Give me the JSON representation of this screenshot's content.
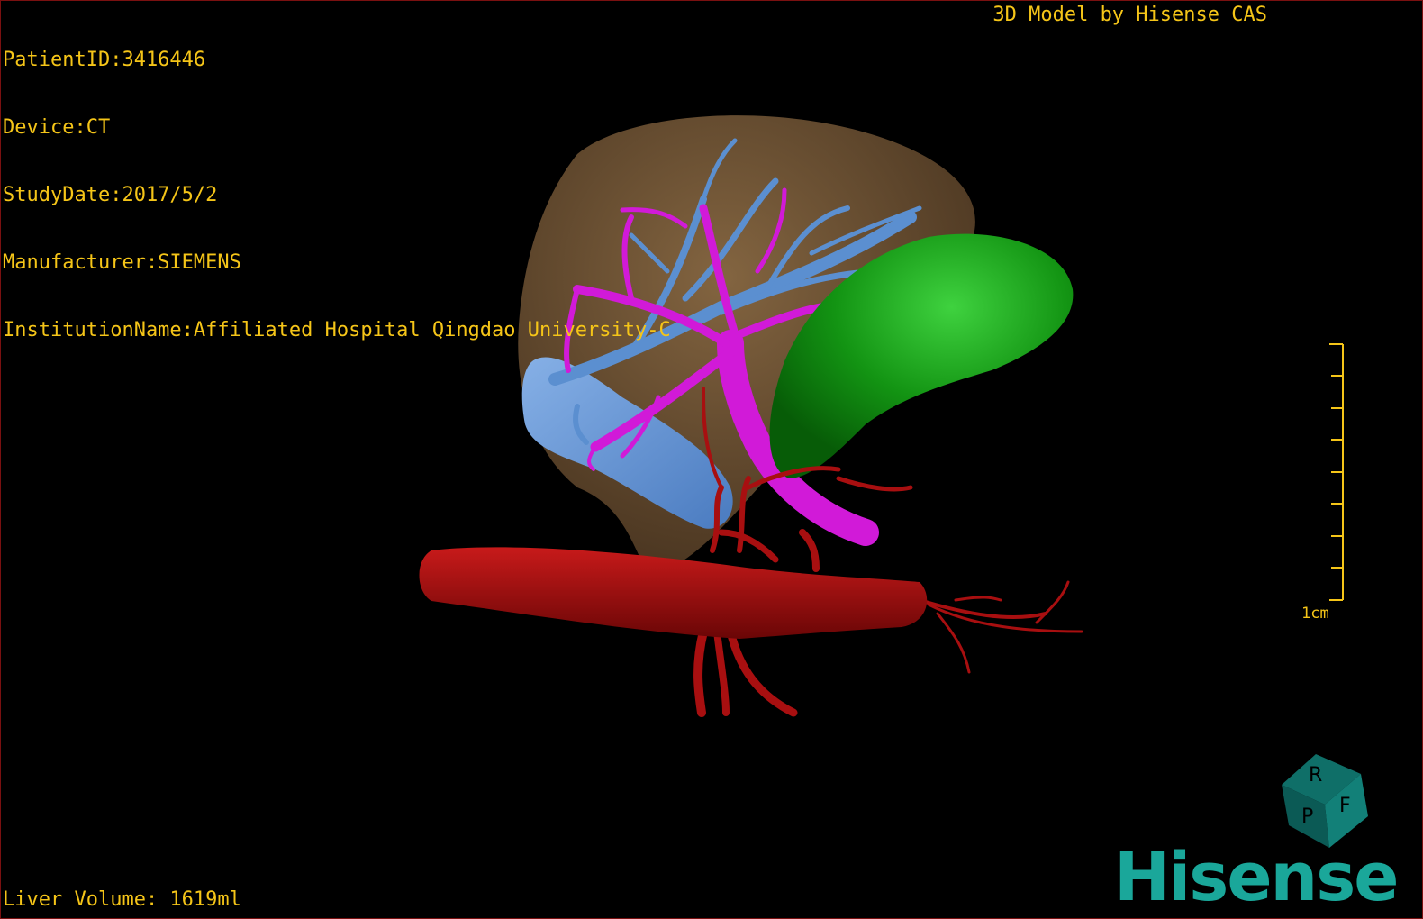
{
  "header": {
    "patient_id": "PatientID:3416446",
    "device": "Device:CT",
    "study_date": "StudyDate:2017/5/2",
    "manufacturer": "Manufacturer:SIEMENS",
    "institution": "InstitutionName:Affiliated Hospital Qingdao University-C",
    "title": "3D Model by Hisense CAS"
  },
  "footer": {
    "liver_volume": "Liver Volume: 1619ml"
  },
  "scale_bar": {
    "label": "1cm"
  },
  "orientation_cube": {
    "faces": [
      "R",
      "F",
      "P"
    ]
  },
  "brand": {
    "logo": "Hisense"
  },
  "colors": {
    "text": "#f5c518",
    "liver": "#7a5a36",
    "spleen": "#169c16",
    "aorta": "#a80f10",
    "portal_vein": "#d11ad8",
    "hepatic_vein": "#5b8fd0",
    "brand": "#1aa79a"
  }
}
